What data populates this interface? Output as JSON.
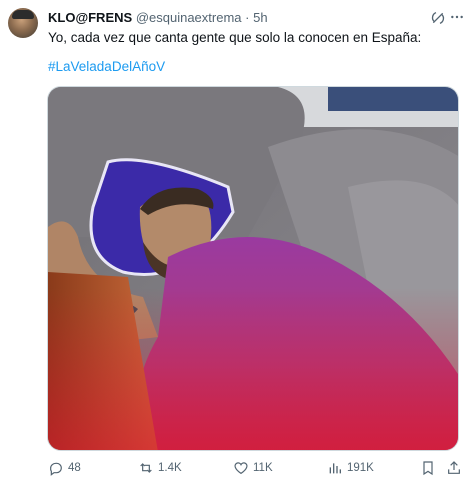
{
  "post": {
    "author_name": "KLO@FRENS",
    "handle": "@esquinaextrema",
    "separator": "·",
    "time": "5h",
    "text": "Yo, cada vez que canta gente que solo la conocen en España:",
    "hashtag": "#LaVeladaDelAñoV"
  },
  "media": {
    "description_icon": "photo-of-man-sleeping-on-couch-under-pink-blanket"
  },
  "actions": {
    "replies": "48",
    "reposts": "1.4K",
    "likes": "11K",
    "views": "191K"
  },
  "colors": {
    "link": "#1d9bf0",
    "text": "#0f1419",
    "muted": "#536471"
  }
}
